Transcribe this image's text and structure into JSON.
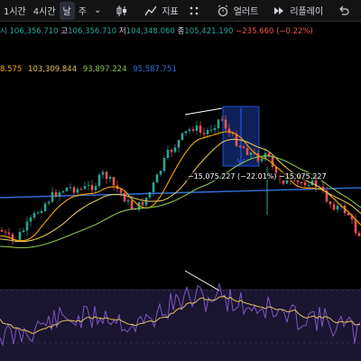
{
  "toolbar": {
    "tf_1h": "1시간",
    "tf_4h": "4시간",
    "tf_day": "날",
    "tf_week": "주",
    "chevron": "⌄",
    "indicators": "지표",
    "alert": "얼러트",
    "replay": "리플레이"
  },
  "ohlc": {
    "open": "시 106,356.710",
    "high_key": "고",
    "high": "106,356.710",
    "low_key": "저",
    "low": "104,348.060",
    "close_key": "종",
    "close": "105,421.190",
    "change": "−235.660 (−0.22%)"
  },
  "ma_values": {
    "ma1": "8.575",
    "ma2": "103,309.844",
    "ma3": "93,897.224",
    "ma4": "95,587.751"
  },
  "measure": {
    "label": "−15,075.227 (−22.01%) −15,075.227"
  },
  "colors": {
    "up": "#26a69a",
    "down": "#ef5350",
    "ma1": "#f7a600",
    "ma2": "#e0c060",
    "ma3": "#8bc34a",
    "ma4": "#2f6fd6",
    "rsi": "#7e57c2",
    "rsi_ma": "#e0c060"
  }
}
